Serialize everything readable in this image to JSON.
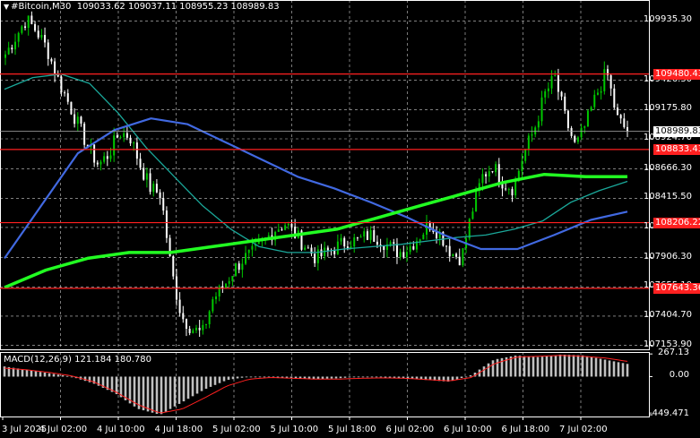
{
  "header": {
    "symbol": "#Bitcoin,M30",
    "ohlc": "109033.62 109037.11 108955.23 108989.83",
    "collapse_glyph": "▼"
  },
  "price_axis": {
    "ticks": [
      "109935.30",
      "109426.30",
      "109175.80",
      "108924.70",
      "108666.30",
      "108415.50",
      "108164.70",
      "107906.30",
      "107655.10",
      "107404.70",
      "107153.90"
    ],
    "range": [
      107120,
      110115
    ]
  },
  "levels": [
    {
      "price": 109480.43,
      "label": "109480.43",
      "color": "#ff2020"
    },
    {
      "price": 108833.43,
      "label": "108833.43",
      "color": "#ff2020"
    },
    {
      "price": 108206.22,
      "label": "108206.22",
      "color": "#ff2020"
    },
    {
      "price": 107643.36,
      "label": "107643.36",
      "color": "#ff2020"
    }
  ],
  "current_price": {
    "price": 108989.83,
    "label": "108989.83"
  },
  "time_axis": [
    "3 Jul 2025",
    "4 Jul 02:00",
    "4 Jul 10:00",
    "4 Jul 18:00",
    "5 Jul 02:00",
    "5 Jul 10:00",
    "5 Jul 18:00",
    "6 Jul 02:00",
    "6 Jul 10:00",
    "6 Jul 18:00",
    "7 Jul 02:00"
  ],
  "macd": {
    "label": "MACD(12,26,9) 121.184 180.780",
    "ticks": [
      "267.13",
      "0.00",
      "-449.471"
    ],
    "range": [
      -470,
      290
    ]
  },
  "colors": {
    "background": "#000000",
    "bull_candle": "#00c800",
    "bear_candle": "#ffffff",
    "grid": "#ffffff",
    "ma_fast": "#1aa89a",
    "ma_mid": "#4169e1",
    "ma_slow": "#22ff22",
    "macd_hist": "#c0c0c0",
    "macd_signal": "#ff2020"
  },
  "chart_data": {
    "type": "candlestick",
    "timeframe": "M30",
    "candle_count": 190,
    "anchor_closes": [
      109650,
      109800,
      109950,
      109850,
      109700,
      109450,
      109250,
      109050,
      108850,
      108700,
      108800,
      108980,
      108950,
      108700,
      108500,
      108450,
      107800,
      107400,
      107300,
      107250,
      107550,
      107650,
      107800,
      107900,
      107950,
      108050,
      108150,
      108200,
      108100,
      108000,
      107900,
      107950,
      108000,
      108050,
      108050,
      108100,
      108080,
      108000,
      107950,
      108000,
      108100,
      108200,
      108100,
      107950,
      107900,
      108300,
      108600,
      108700,
      108550,
      108500,
      108800,
      109000,
      109300,
      109450,
      109100,
      108850,
      109050,
      109300,
      109500,
      109100,
      108989.83
    ],
    "ma_fast_points": [
      109350,
      109450,
      109480,
      109400,
      109150,
      108850,
      108600,
      108350,
      108150,
      108000,
      107950,
      107950,
      107980,
      108000,
      108020,
      108050,
      108080,
      108100,
      108150,
      108220,
      108380,
      108480,
      108560
    ],
    "ma_mid_points": [
      107900,
      108350,
      108800,
      109000,
      109100,
      109050,
      108900,
      108750,
      108600,
      108500,
      108380,
      108250,
      108100,
      107980,
      107980,
      108100,
      108230,
      108300
    ],
    "ma_slow_points": [
      107650,
      107800,
      107900,
      107950,
      107950,
      108000,
      108050,
      108100,
      108150,
      108250,
      108350,
      108450,
      108550,
      108620,
      108600,
      108600
    ],
    "macd_hist_points": [
      120,
      80,
      40,
      0,
      -80,
      -200,
      -380,
      -449,
      -300,
      -150,
      -40,
      0,
      -10,
      -20,
      -30,
      -20,
      0,
      -10,
      -20,
      -40,
      -60,
      20,
      200,
      250,
      230,
      260,
      250,
      200,
      150
    ],
    "macd_signal_points": [
      100,
      80,
      50,
      10,
      -60,
      -180,
      -330,
      -430,
      -380,
      -250,
      -110,
      -30,
      -10,
      -20,
      -30,
      -30,
      -20,
      -15,
      -20,
      -35,
      -50,
      -10,
      150,
      230,
      240,
      250,
      240,
      220,
      180
    ]
  }
}
